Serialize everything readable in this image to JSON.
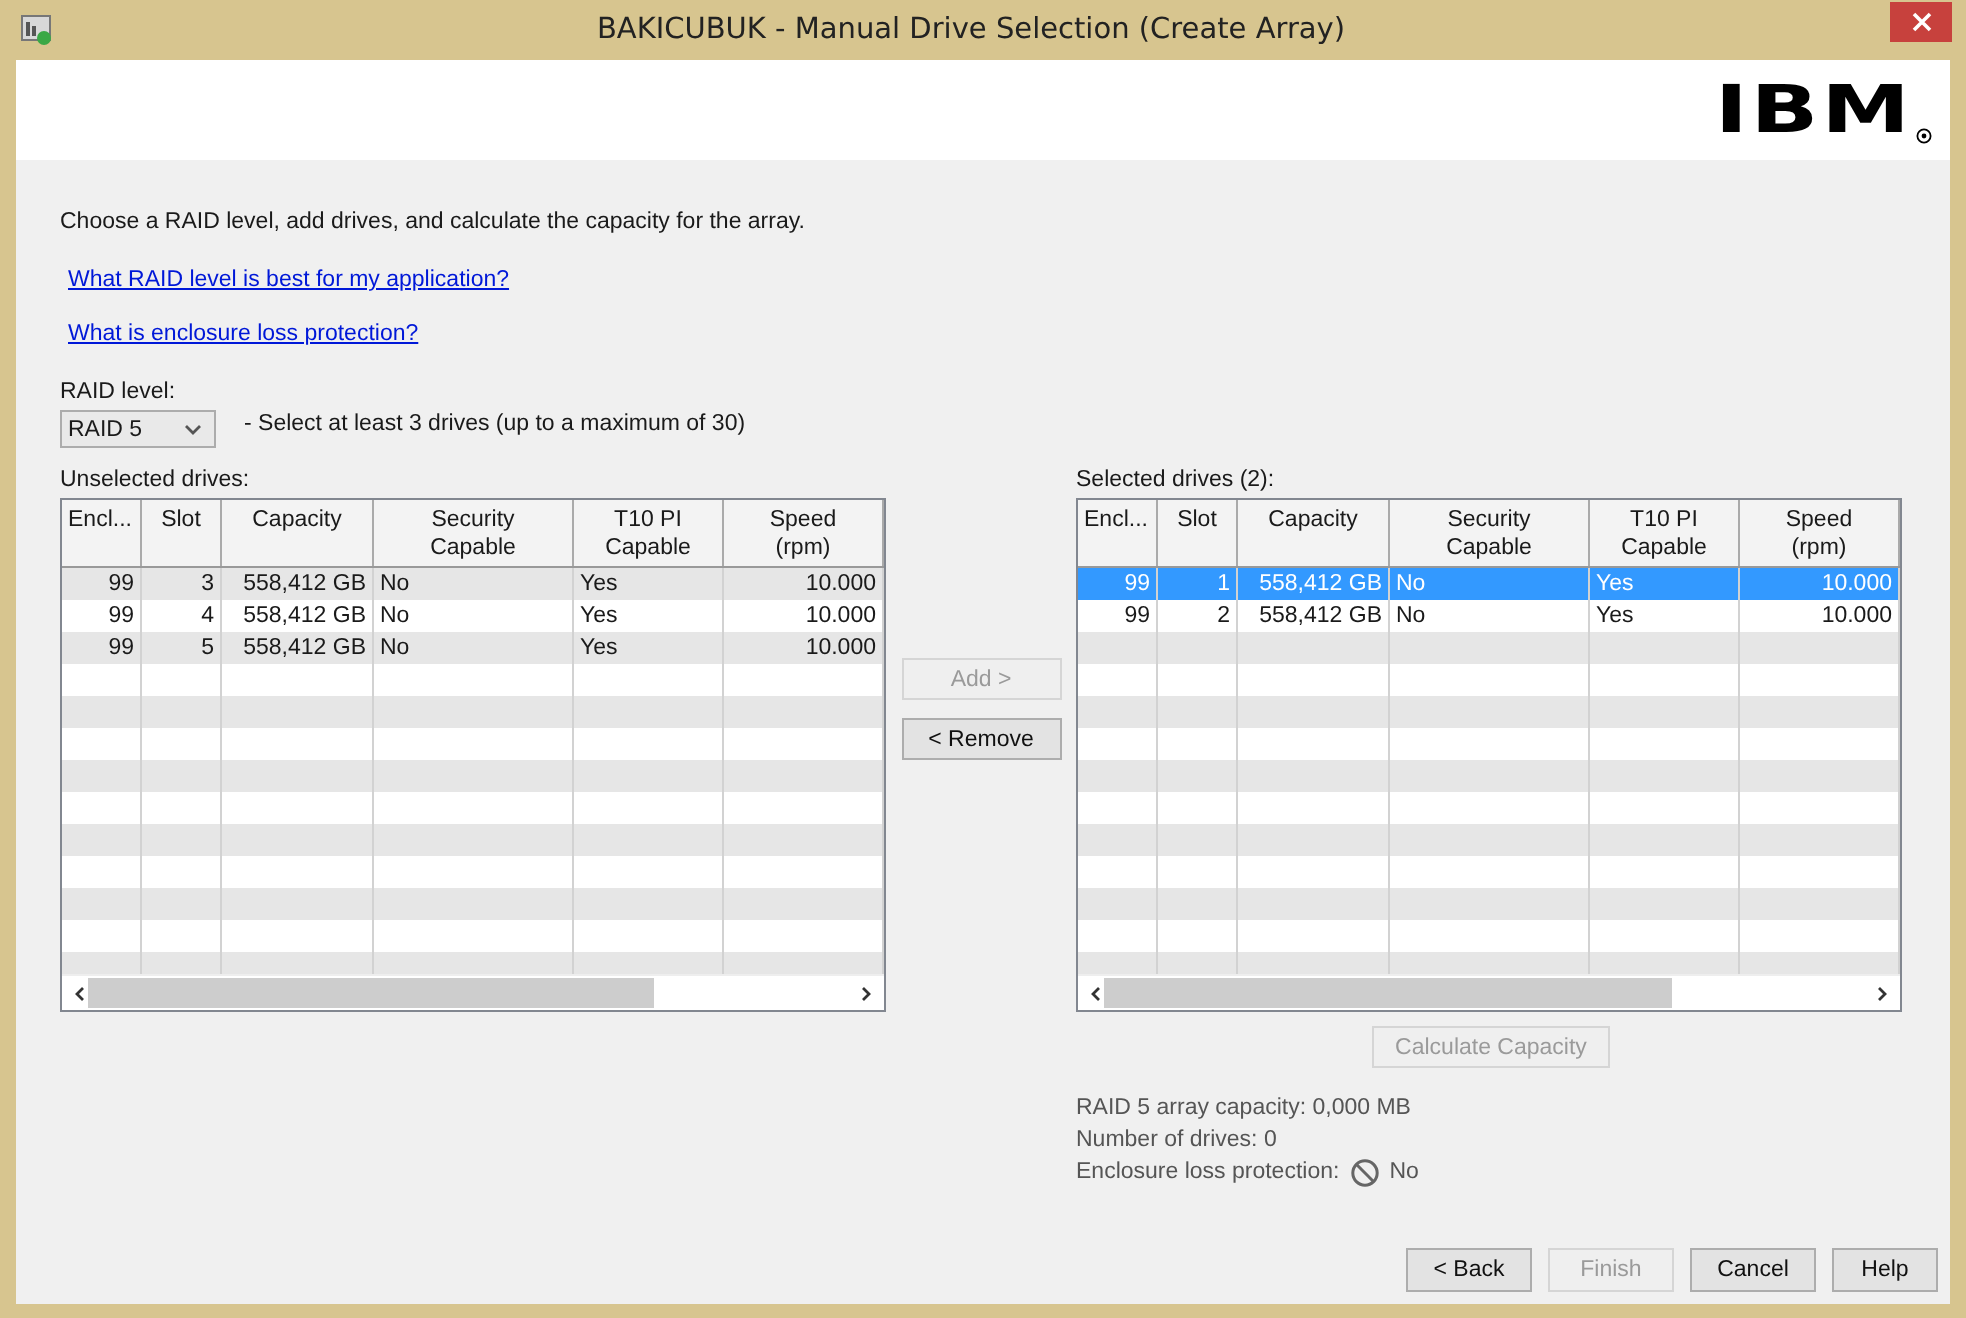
{
  "window": {
    "title": "BAKICUBUK - Manual Drive Selection (Create Array)",
    "logo": "IBM"
  },
  "intro": "Choose a RAID level, add drives, and calculate the capacity for the array.",
  "links": [
    "What RAID level is best for my application?",
    "What is enclosure loss protection?"
  ],
  "raid": {
    "label": "RAID level:",
    "value": "RAID 5",
    "hint": "- Select at least 3 drives (up to a maximum of 30)"
  },
  "unselected": {
    "label": "Unselected drives:",
    "columns": [
      "Encl...",
      "Slot",
      "Capacity",
      "Security\nCapable",
      "T10 PI\nCapable",
      "Speed\n(rpm)"
    ],
    "rows": [
      {
        "cells": [
          "99",
          "3",
          "558,412 GB",
          "No",
          "Yes",
          "10.000"
        ],
        "selected": false
      },
      {
        "cells": [
          "99",
          "4",
          "558,412 GB",
          "No",
          "Yes",
          "10.000"
        ],
        "selected": false
      },
      {
        "cells": [
          "99",
          "5",
          "558,412 GB",
          "No",
          "Yes",
          "10.000"
        ],
        "selected": false
      }
    ]
  },
  "selected": {
    "label": "Selected drives (2):",
    "columns": [
      "Encl...",
      "Slot",
      "Capacity",
      "Security\nCapable",
      "T10 PI\nCapable",
      "Speed\n(rpm)"
    ],
    "rows": [
      {
        "cells": [
          "99",
          "1",
          "558,412 GB",
          "No",
          "Yes",
          "10.000"
        ],
        "selected": true
      },
      {
        "cells": [
          "99",
          "2",
          "558,412 GB",
          "No",
          "Yes",
          "10.000"
        ],
        "selected": false
      }
    ]
  },
  "move_buttons": [
    {
      "label": "Add >",
      "disabled": true
    },
    {
      "label": "< Remove",
      "disabled": false
    }
  ],
  "calculate": {
    "label": "Calculate Capacity",
    "disabled": true
  },
  "info": {
    "capacity": "RAID 5 array capacity: 0,000 MB",
    "drives": "Number of drives: 0",
    "protection_label": "Enclosure loss protection:",
    "protection_value": "No"
  },
  "footer_buttons": [
    {
      "label": "< Back",
      "disabled": false
    },
    {
      "label": "Finish",
      "disabled": true
    },
    {
      "label": "Cancel",
      "disabled": false
    },
    {
      "label": "Help",
      "disabled": false
    }
  ]
}
